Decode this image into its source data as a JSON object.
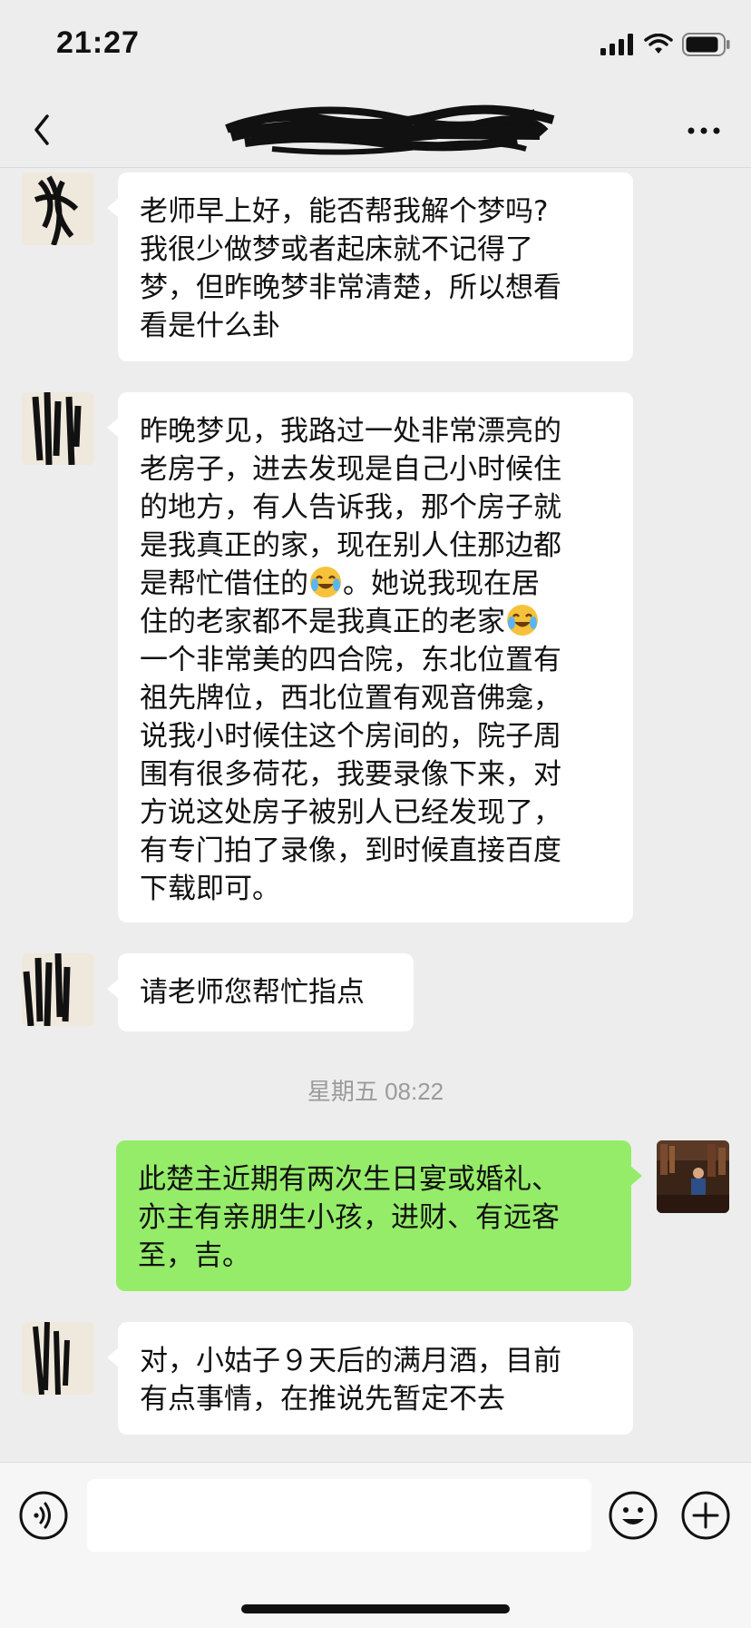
{
  "status_bar": {
    "time": "21:27"
  },
  "nav": {
    "title_redacted": true,
    "back_icon": "chevron-left-icon",
    "more_icon": "more-dots-icon"
  },
  "messages": {
    "m1": {
      "sender": "contact",
      "lines": [
        "老师早上好，能否帮我解个梦吗?",
        "我很少做梦或者起床就不记得了",
        "梦，但昨晚梦非常清楚，所以想看",
        "看是什么卦"
      ]
    },
    "m2": {
      "sender": "contact",
      "lines": [
        "昨晚梦见，我路过一处非常漂亮的",
        "老房子，进去发现是自己小时候住",
        "的地方，有人告诉我，那个房子就",
        "是我真正的家，现在别人住那边都",
        "是帮忙借住的",
        "。她说我现在居",
        "住的老家都不是我真正的老家",
        "一个非常美的四合院，东北位置有",
        "祖先牌位，西北位置有观音佛龛，",
        "说我小时候住这个房间的，院子周",
        "围有很多荷花，我要录像下来，对",
        "方说这处房子被别人已经发现了，",
        "有专门拍了录像，到时候直接百度",
        "下载即可。"
      ],
      "emoji": "crying-laughing-emoji"
    },
    "m3": {
      "sender": "contact",
      "lines": [
        "请老师您帮忙指点"
      ]
    },
    "timestamp": "星期五 08:22",
    "m4": {
      "sender": "me",
      "lines": [
        "此楚主近期有两次生日宴或婚礼、",
        "亦主有亲朋生小孩，进财、有远客",
        "至，吉。"
      ]
    },
    "m5": {
      "sender": "contact",
      "lines": [
        "对，小姑子９天后的满月酒，目前",
        "有点事情，在推说先暂定不去"
      ]
    }
  },
  "input": {
    "value": "",
    "voice_icon": "voice-icon",
    "emoji_icon": "emoji-icon",
    "plus_icon": "plus-icon"
  },
  "colors": {
    "background": "#ededed",
    "bubble_in": "#ffffff",
    "bubble_out": "#95ec69",
    "timestamp": "#9b9b9b"
  }
}
